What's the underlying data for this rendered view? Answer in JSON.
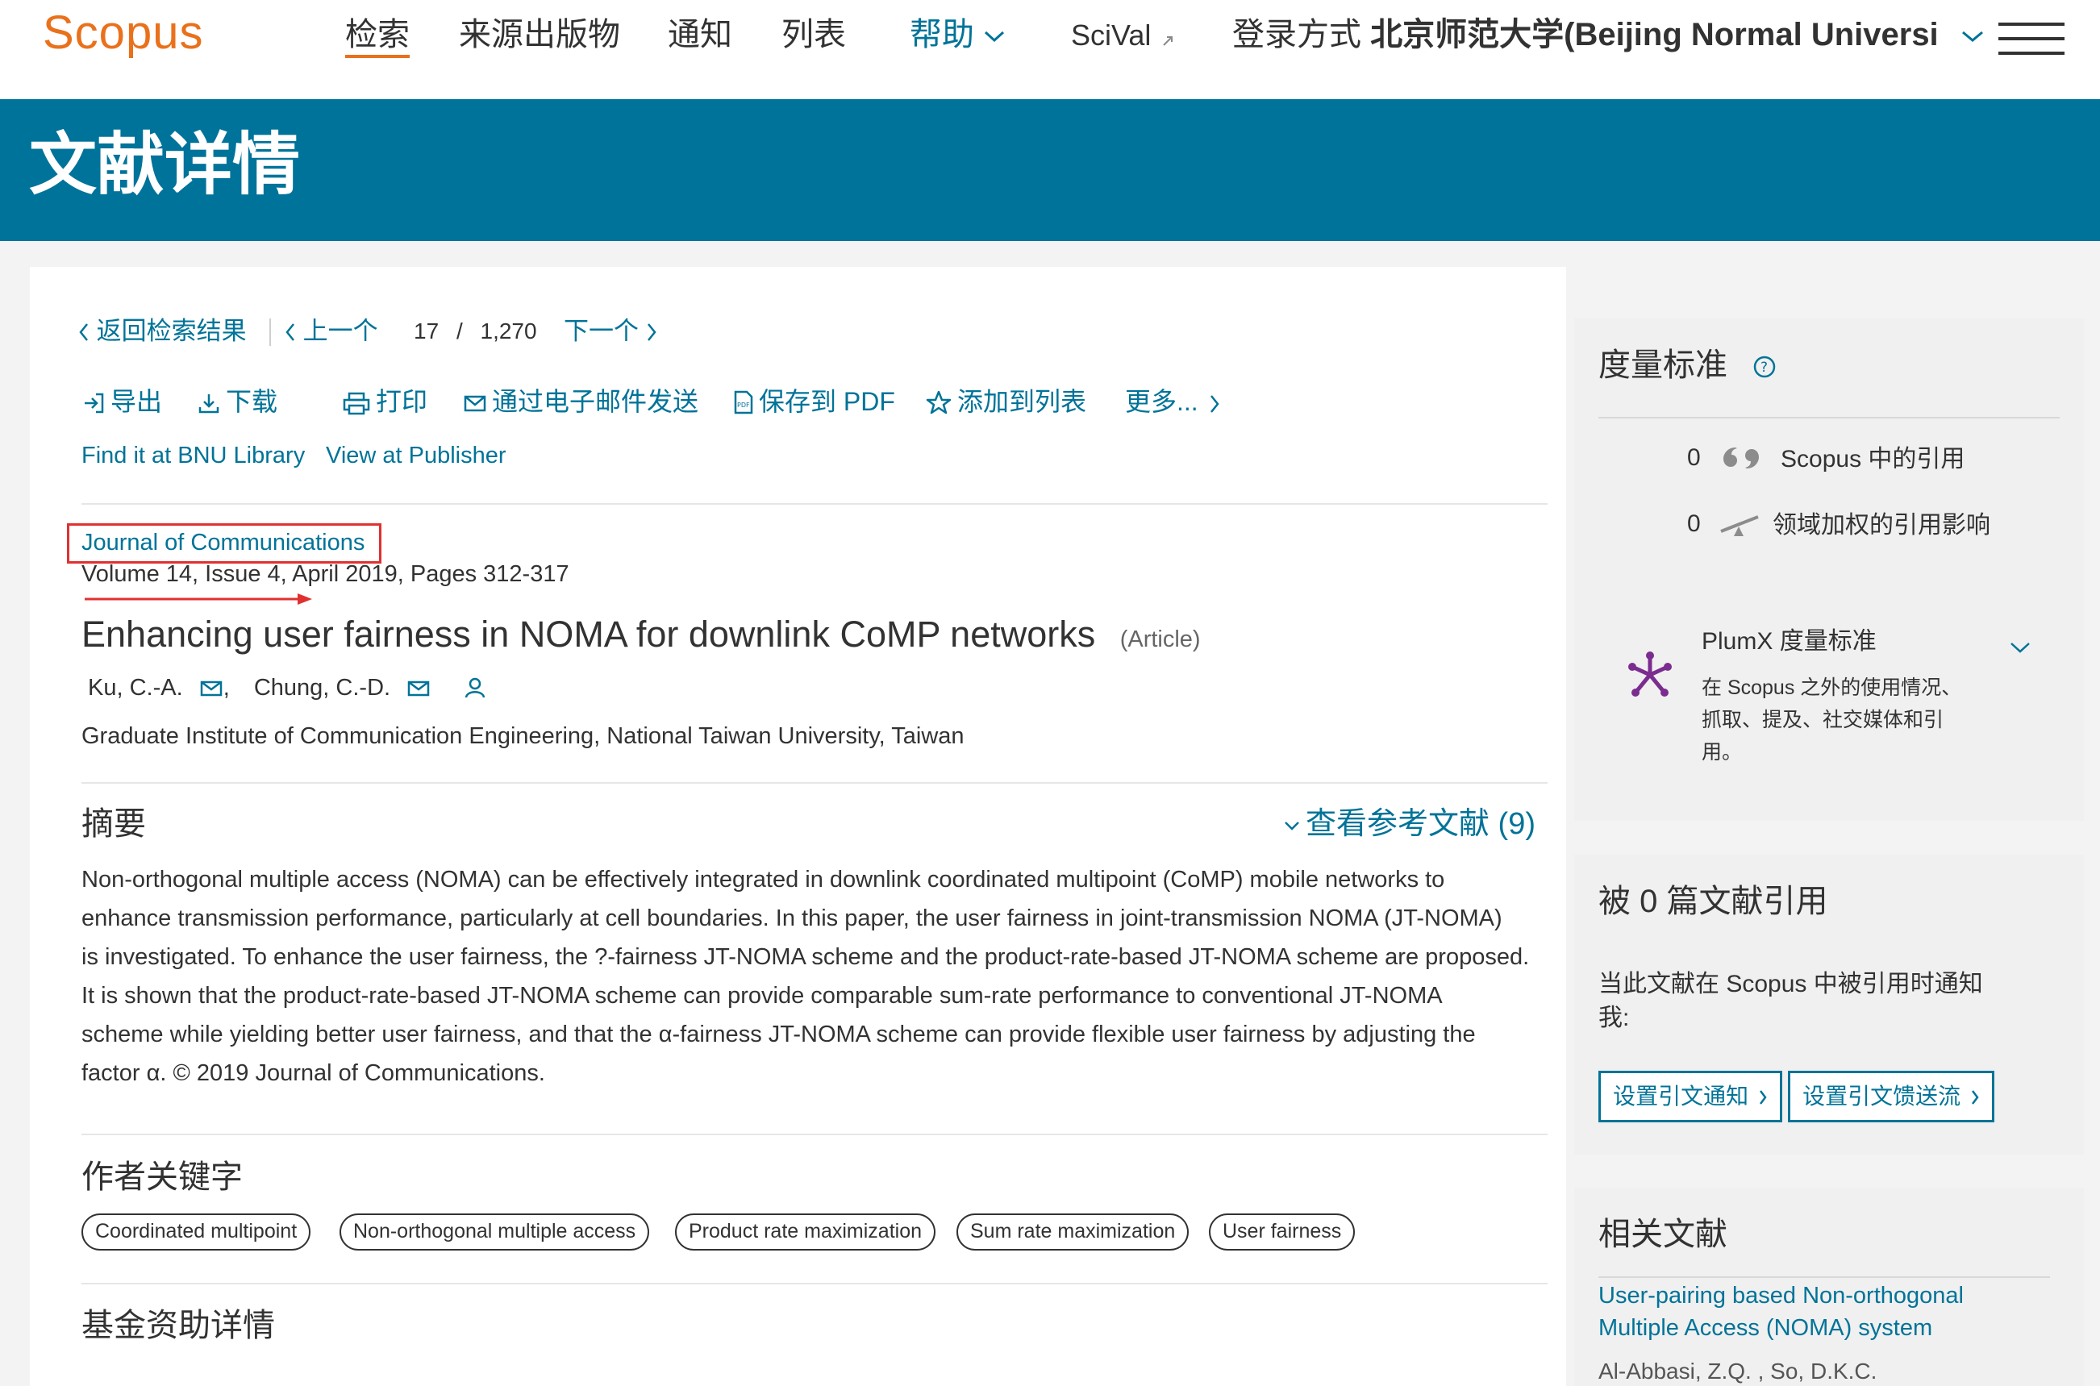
{
  "nav": {
    "logo": "Scopus",
    "items": [
      {
        "label": "检索"
      },
      {
        "label": "来源出版物"
      },
      {
        "label": "通知"
      },
      {
        "label": "列表"
      },
      {
        "label": "帮助"
      },
      {
        "label": "SciVal"
      }
    ],
    "login_prefix": "登录方式",
    "login_institution": "北京师范大学(Beijing Normal Universi"
  },
  "banner": {
    "title": "文献详情"
  },
  "crumbs": {
    "back": "返回检索结果",
    "prev": "上一个",
    "current": "17",
    "separator": "/",
    "total": "1,270",
    "next": "下一个"
  },
  "toolbar": {
    "export": "导出",
    "download": "下载",
    "print": "打印",
    "email": "通过电子邮件发送",
    "save_pdf": "保存到 PDF",
    "add_list": "添加到列表",
    "more": "更多..."
  },
  "links": {
    "library": "Find it at BNU Library",
    "publisher": "View at Publisher"
  },
  "doc": {
    "journal": "Journal of Communications",
    "citation": "Volume 14, Issue 4, April 2019, Pages 312-317",
    "title": "Enhancing user fairness in NOMA for downlink CoMP networks",
    "type": "(Article)",
    "author1": "Ku, C.-A.",
    "comma": ",",
    "author2": "Chung, C.-D.",
    "affiliation": "Graduate Institute of Communication Engineering, National Taiwan University, Taiwan"
  },
  "abstract": {
    "heading": "摘要",
    "references_link": "查看参考文献 (9)",
    "lines": [
      "Non-orthogonal multiple access (NOMA) can be effectively integrated in downlink coordinated multipoint (CoMP) mobile networks to",
      "enhance transmission performance, particularly at cell boundaries. In this paper, the user fairness in joint-transmission NOMA (JT-NOMA)",
      "is investigated. To enhance the user fairness, the ?-fairness JT-NOMA scheme and the product-rate-based JT-NOMA scheme are proposed.",
      "It is shown that the product-rate-based JT-NOMA scheme can provide comparable sum-rate performance to conventional JT-NOMA",
      "scheme while yielding better user fairness, and that the α-fairness JT-NOMA scheme can provide flexible user fairness by adjusting the",
      "factor α. © 2019 Journal of Communications."
    ]
  },
  "keywords": {
    "heading": "作者关键字",
    "items": [
      "Coordinated multipoint",
      "Non-orthogonal multiple access",
      "Product rate maximization",
      "Sum rate maximization",
      "User fairness"
    ]
  },
  "funding": {
    "heading": "基金资助详情"
  },
  "metrics": {
    "heading": "度量标准",
    "citations_count": "0",
    "citations_label": "Scopus 中的引用",
    "fwci_count": "0",
    "fwci_label": "领域加权的引用影响",
    "plumx_title": "PlumX 度量标准",
    "plumx_line1": "在 Scopus 之外的使用情况、",
    "plumx_line2": "抓取、提及、社交媒体和引",
    "plumx_line3": "用。"
  },
  "cited_by": {
    "heading": "被 0 篇文献引用",
    "notice_line1": "当此文献在 Scopus 中被引用时通知",
    "notice_line2": "我:",
    "btn_alert": "设置引文通知",
    "btn_feed": "设置引文馈送流"
  },
  "related": {
    "heading": "相关文献",
    "item1_line1": "User-pairing based Non-orthogonal",
    "item1_line2": "Multiple Access (NOMA) system",
    "item1_authors": "Al-Abbasi, Z.Q. , So, D.K.C."
  },
  "colors": {
    "brand_orange": "#e9711c",
    "banner_blue": "#00739a",
    "link_blue": "#007398",
    "highlight_red": "#e03131"
  }
}
